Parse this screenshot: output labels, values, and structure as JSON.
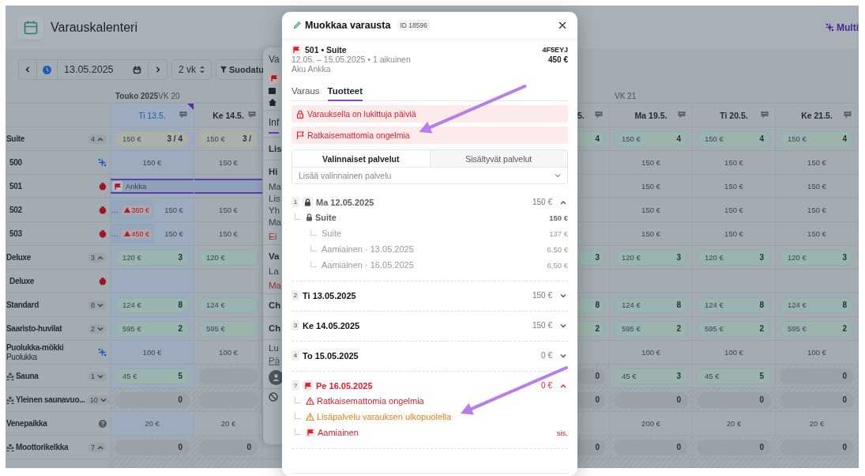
{
  "header": {
    "title": "Varauskalenteri",
    "brand": "Multi"
  },
  "toolbar": {
    "date": "13.05.2025",
    "range": "2 vk",
    "filter": "Suodatu"
  },
  "calendar": {
    "month": "Touko 2025",
    "weeks": [
      "VK 20",
      "VK 21"
    ],
    "days": [
      {
        "label": "Ti 13.5.",
        "selected": true,
        "kind": "full"
      },
      {
        "label": "Ke 14.5.",
        "selected": false,
        "kind": "full"
      },
      {
        "label": "5.",
        "selected": false,
        "kind": "partial"
      },
      {
        "label": "Ma 19.5.",
        "selected": false,
        "kind": "full"
      },
      {
        "label": "Ti 20.5.",
        "selected": false,
        "kind": "full"
      },
      {
        "label": "Ke 21.5.",
        "selected": false,
        "kind": "full"
      }
    ],
    "rows": [
      {
        "label": "Suite",
        "kind": "group",
        "count": "4",
        "expanded": true,
        "cells": [
          {
            "kind": "pill-warn",
            "price": "150 €",
            "count": "3 / 4"
          },
          {
            "kind": "pill-warn",
            "price": "150 €",
            "count": "3 /"
          },
          {
            "kind": "pill",
            "count": "4"
          },
          {
            "kind": "pill",
            "price": "150 €",
            "count": "4"
          },
          {
            "kind": "pill",
            "price": "150 €",
            "count": "4"
          },
          {
            "kind": "pill",
            "price": "150 €",
            "count": "4"
          }
        ]
      },
      {
        "label": "500",
        "kind": "unit-linked",
        "cells": [
          {
            "kind": "price",
            "text": "150 €"
          },
          {
            "kind": "price",
            "text": "150 €"
          },
          {
            "kind": "blank"
          },
          {
            "kind": "price",
            "text": "150 €"
          },
          {
            "kind": "price",
            "text": "150 €"
          },
          {
            "kind": "price",
            "text": "150 €"
          }
        ]
      },
      {
        "label": "501",
        "kind": "unit-alert",
        "cells": [
          {
            "kind": "booking",
            "text": "Ankka"
          },
          {
            "kind": "booking-cont"
          },
          {
            "kind": "blank"
          },
          {
            "kind": "price",
            "text": "150 €"
          },
          {
            "kind": "price",
            "text": "150 €"
          },
          {
            "kind": "price",
            "text": "150 €"
          }
        ]
      },
      {
        "label": "502",
        "kind": "unit-alert",
        "cells": [
          {
            "kind": "split",
            "text": "…",
            "tag": "360 €",
            "price": "150 €"
          },
          {
            "kind": "price",
            "text": "150 €"
          },
          {
            "kind": "blank"
          },
          {
            "kind": "price",
            "text": "150 €"
          },
          {
            "kind": "price",
            "text": "150 €"
          },
          {
            "kind": "price",
            "text": "150 €"
          }
        ]
      },
      {
        "label": "503",
        "kind": "unit-alert",
        "cells": [
          {
            "kind": "split",
            "text": "…",
            "tag": "450 €",
            "price": "150 €"
          },
          {
            "kind": "price",
            "text": "150 €"
          },
          {
            "kind": "blank"
          },
          {
            "kind": "price",
            "text": "150 €"
          },
          {
            "kind": "price",
            "text": "150 €"
          },
          {
            "kind": "price",
            "text": "150 €"
          }
        ]
      },
      {
        "label": "Deluxe",
        "kind": "group",
        "count": "3",
        "expanded": true,
        "cells": [
          {
            "kind": "pill",
            "price": "120 €",
            "count": "3"
          },
          {
            "kind": "pill",
            "price": "120 €"
          },
          {
            "kind": "pill",
            "count": "3"
          },
          {
            "kind": "pill",
            "price": "120 €",
            "count": "3"
          },
          {
            "kind": "pill",
            "price": "120 €",
            "count": "3"
          },
          {
            "kind": "pill",
            "price": "120 €",
            "count": "3"
          }
        ]
      },
      {
        "label": "Deluxe",
        "kind": "unit-alert",
        "cells": [
          {
            "kind": "blank"
          },
          {
            "kind": "blank"
          },
          {
            "kind": "blank"
          },
          {
            "kind": "blank"
          },
          {
            "kind": "blank"
          },
          {
            "kind": "blank"
          }
        ]
      },
      {
        "label": "Standard",
        "kind": "group",
        "count": "8",
        "expanded": false,
        "cells": [
          {
            "kind": "pill",
            "price": "124 €",
            "count": "8"
          },
          {
            "kind": "pill",
            "price": "124 €"
          },
          {
            "kind": "pill",
            "count": "8"
          },
          {
            "kind": "pill",
            "price": "124 €",
            "count": "8"
          },
          {
            "kind": "pill",
            "price": "124 €",
            "count": "8"
          },
          {
            "kind": "pill",
            "price": "124 €",
            "count": "8"
          }
        ]
      },
      {
        "label": "Saaristo-huvilat",
        "kind": "group",
        "count": "2",
        "expanded": false,
        "cells": [
          {
            "kind": "pill",
            "price": "595 €",
            "count": "2"
          },
          {
            "kind": "pill",
            "price": "595 €"
          },
          {
            "kind": "pill",
            "count": "2"
          },
          {
            "kind": "pill",
            "price": "595 €",
            "count": "2"
          },
          {
            "kind": "pill",
            "price": "595 €",
            "count": "2"
          },
          {
            "kind": "pill",
            "price": "595 €",
            "count": "2"
          }
        ]
      },
      {
        "label": "Puolukka-mökki",
        "sublabel": "Puolukka",
        "kind": "resource-linked",
        "cells": [
          {
            "kind": "price",
            "text": "100 €"
          },
          {
            "kind": "price",
            "text": "100 €"
          },
          {
            "kind": "blank"
          },
          {
            "kind": "price",
            "text": "100 €"
          },
          {
            "kind": "price",
            "text": "100 €"
          },
          {
            "kind": "price",
            "text": "100 €"
          }
        ]
      },
      {
        "label": "Sauna",
        "kind": "service-group",
        "count": "1",
        "expanded": false,
        "cells": [
          {
            "kind": "pill",
            "price": "45 €",
            "count": "5"
          },
          {
            "kind": "zero"
          },
          {
            "kind": "zero",
            "count": "0"
          },
          {
            "kind": "pill",
            "price": "45 €",
            "count": "3"
          },
          {
            "kind": "pill",
            "price": "45 €",
            "count": "5"
          },
          {
            "kind": "zero",
            "count": "0"
          }
        ]
      },
      {
        "label": "Yleinen saunavuo...",
        "kind": "service-group",
        "count": "10",
        "expanded": false,
        "cells": [
          {
            "kind": "zero",
            "count": "0"
          },
          {
            "kind": "zero"
          },
          {
            "kind": "zero",
            "count": "0"
          },
          {
            "kind": "zero",
            "count": "0"
          },
          {
            "kind": "zero",
            "count": "0"
          },
          {
            "kind": "zero",
            "count": "0"
          }
        ]
      },
      {
        "label": "Venepaikka",
        "kind": "resource-unknown",
        "cells": [
          {
            "kind": "price",
            "text": "20 €"
          },
          {
            "kind": "price",
            "text": "20 €"
          },
          {
            "kind": "blank"
          },
          {
            "kind": "price",
            "text": "200 €"
          },
          {
            "kind": "price",
            "text": "20 €"
          },
          {
            "kind": "price",
            "text": "20 €"
          }
        ]
      },
      {
        "label": "Moottorikelkka",
        "kind": "service-group",
        "count": "7",
        "expanded": true,
        "cells": [
          {
            "kind": "zero",
            "count": "0"
          },
          {
            "kind": "zero",
            "count": "0"
          },
          {
            "kind": "zero",
            "count": "0"
          },
          {
            "kind": "zero",
            "count": "0"
          },
          {
            "kind": "zero",
            "count": "0"
          },
          {
            "kind": "zero",
            "count": "0"
          }
        ]
      }
    ]
  },
  "side_panel": {
    "sections": [
      [
        {
          "kind": "title",
          "text": "Va"
        },
        {
          "kind": "flag"
        },
        {
          "kind": "calendar"
        },
        {
          "kind": "home"
        }
      ],
      [
        {
          "kind": "tab",
          "text": "Inf",
          "selected": true
        }
      ],
      [
        {
          "kind": "heading",
          "text": "Lis"
        }
      ],
      [
        {
          "kind": "heading",
          "text": "Hi"
        },
        {
          "kind": "text",
          "text": "Ma"
        },
        {
          "kind": "text",
          "text": "Lis"
        },
        {
          "kind": "text",
          "text": "Yh"
        },
        {
          "kind": "text",
          "text": "Ma"
        },
        {
          "kind": "alert",
          "text": "Ei"
        }
      ],
      [
        {
          "kind": "heading",
          "text": "Va"
        },
        {
          "kind": "text",
          "text": "La"
        },
        {
          "kind": "alert",
          "text": "Ma"
        }
      ],
      [
        {
          "kind": "heading",
          "text": "Ch"
        }
      ],
      [
        {
          "kind": "heading",
          "text": "Ch"
        }
      ],
      [
        {
          "kind": "text",
          "text": "Lu"
        },
        {
          "kind": "link",
          "text": "Pä"
        },
        {
          "kind": "avatar"
        }
      ],
      [
        {
          "kind": "ban"
        }
      ]
    ]
  },
  "modal": {
    "title": "Muokkaa varausta",
    "id": "ID 18596",
    "booking": {
      "unit": "501 • Suite",
      "flagged": true,
      "code": "4F5EYJ",
      "dates": "12.05. – 15.05.2025 • 1 aikuinen",
      "total": "450 €",
      "guest": "Aku Ankka"
    },
    "tabs": [
      {
        "label": "Varaus",
        "selected": false
      },
      {
        "label": "Tuotteet",
        "selected": true
      }
    ],
    "alerts": [
      {
        "kind": "locked",
        "text": "Varauksella on lukittuja päiviä"
      },
      {
        "kind": "issues",
        "text": "Ratkaisemattomia ongelmia"
      }
    ],
    "segments": [
      {
        "label": "Valinnaiset palvelut",
        "selected": true
      },
      {
        "label": "Sisältyvät palvelut",
        "selected": false
      }
    ],
    "service_select": {
      "placeholder": "Lisää valinnainen palvelu"
    },
    "days": [
      {
        "index": "1",
        "label": "Ma 12.05.2025",
        "price": "150 €",
        "locked": true,
        "flagged": false,
        "expanded": true,
        "children": [
          {
            "kind": "locked",
            "label": "Suite",
            "price": "150 €",
            "children": [
              {
                "kind": "line",
                "label": "Suite",
                "price": "137 €"
              },
              {
                "kind": "line",
                "label": "Aamiainen · 13.05.2025",
                "price": "6,50 €"
              },
              {
                "kind": "line",
                "label": "Aamiainen · 16.05.2025",
                "price": "6,50 €"
              }
            ]
          }
        ]
      },
      {
        "index": "2",
        "label": "Ti 13.05.2025",
        "price": "150 €",
        "locked": false,
        "flagged": false,
        "expanded": false
      },
      {
        "index": "3",
        "label": "Ke 14.05.2025",
        "price": "150 €",
        "locked": false,
        "flagged": false,
        "expanded": false
      },
      {
        "index": "4",
        "label": "To 15.05.2025",
        "price": "0 €",
        "locked": false,
        "flagged": false,
        "expanded": false
      },
      {
        "index": "?",
        "label": "Pe 16.05.2025",
        "price": "0 €",
        "locked": false,
        "flagged": true,
        "expanded": true,
        "children": [
          {
            "kind": "issue",
            "label": "Ratkaisemattomia ongelmia"
          },
          {
            "kind": "warning",
            "label": "Lisäpalvelu varauksen ulkopuolella"
          },
          {
            "kind": "flagged",
            "label": "Aamiainen",
            "price": "sis."
          }
        ]
      }
    ]
  },
  "annotations": [
    {
      "kind": "arrow"
    },
    {
      "kind": "arrow"
    }
  ]
}
